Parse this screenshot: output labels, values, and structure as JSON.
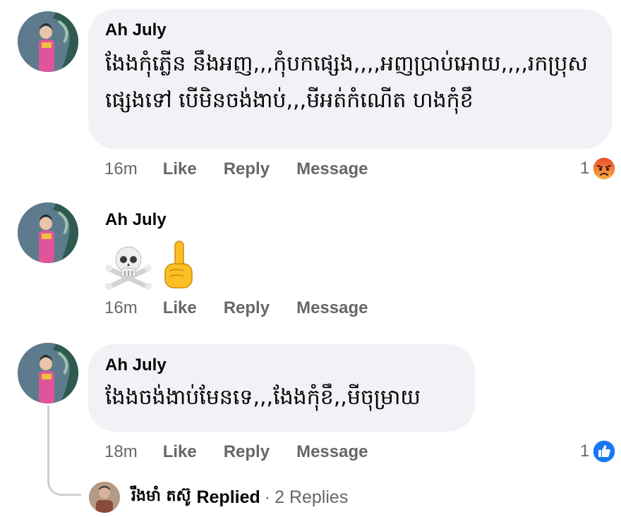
{
  "colors": {
    "bubble": "#f0f2f5",
    "secondary_text": "#65676b",
    "like_blue": "#1877f2",
    "angry": "#f7714c"
  },
  "comments": [
    {
      "author": "Ah July",
      "text": "ងែងកុំភ្លើន នឹងអញ,,,កុំបកផ្សេង,,,,អញប្រាប់អោយ,,,,រកប្រុសផ្សេងទៅ បើមិនចង់ងាប់,,,មីអត់កំណើត ហងកុំខឹ",
      "time": "16m",
      "like": "Like",
      "reply": "Reply",
      "message": "Message",
      "reaction_count": "1",
      "reaction_icon": "angry-reaction-icon"
    },
    {
      "author": "Ah July",
      "emojis": [
        "skull-and-crossbones-icon",
        "pointing-up-icon"
      ],
      "time": "16m",
      "like": "Like",
      "reply": "Reply",
      "message": "Message"
    },
    {
      "author": "Ah July",
      "text": "ងែងចង់ងាប់មែនទេ,,,ងែងកុំខឹ,,មីចុម្រាយ",
      "time": "18m",
      "like": "Like",
      "reply": "Reply",
      "message": "Message",
      "reaction_count": "1",
      "reaction_icon": "like-reaction-icon"
    }
  ],
  "replies": {
    "name": "រឹងមាំ តស៊ូ",
    "replied": "Replied",
    "separator": "·",
    "count": "2 Replies"
  }
}
